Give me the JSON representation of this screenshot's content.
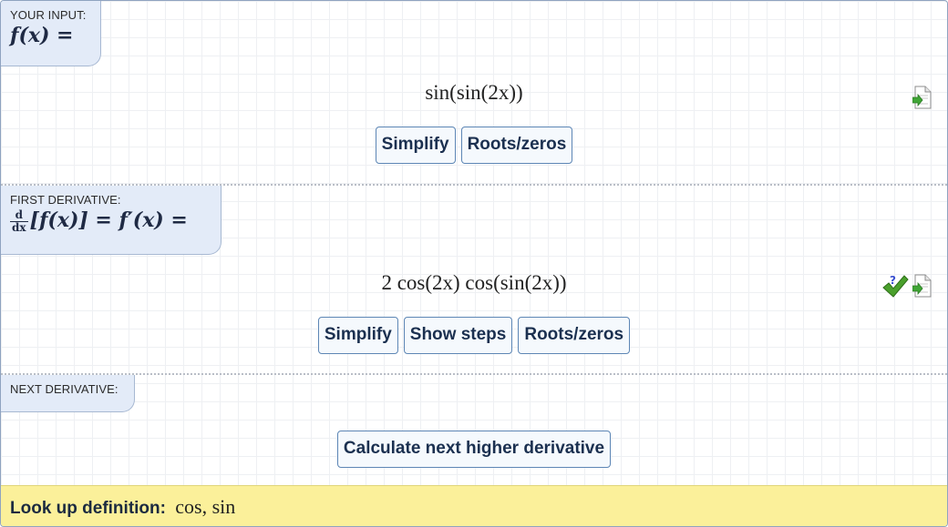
{
  "input_section": {
    "label": "YOUR INPUT:",
    "func_lhs": "f(x) =",
    "expression": "sin(sin(2x))",
    "buttons": {
      "simplify": "Simplify",
      "roots": "Roots/zeros"
    }
  },
  "derivative_section": {
    "label": "FIRST DERIVATIVE:",
    "frac_num": "d",
    "frac_den": "dx",
    "lhs": "[f(x)] = f′(x) =",
    "expression": "2 cos(2x) cos(sin(2x))",
    "buttons": {
      "simplify": "Simplify",
      "show_steps": "Show steps",
      "roots": "Roots/zeros"
    }
  },
  "next_section": {
    "label": "NEXT DERIVATIVE:",
    "button": "Calculate next higher derivative"
  },
  "lookup": {
    "label": "Look up definition:",
    "terms": "cos, sin"
  },
  "icons": {
    "export": "export-document-icon",
    "check": "check-answer-icon"
  },
  "colors": {
    "label_bg": "#e3ebf8",
    "button_border": "#5d86b5",
    "button_text": "#1b3050",
    "lookup_bg": "#fbf09a",
    "check_green": "#4aa02c",
    "check_question": "#3a4fd0"
  }
}
